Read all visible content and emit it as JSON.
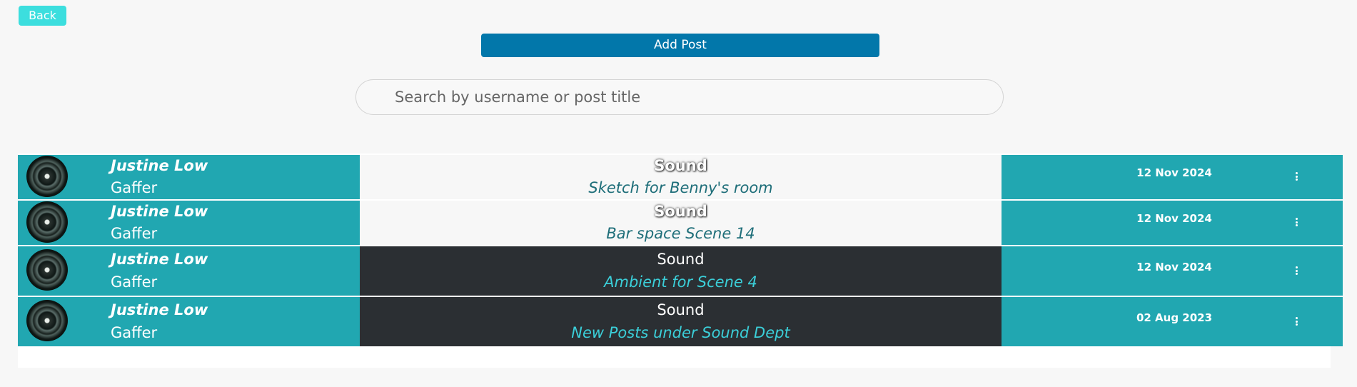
{
  "toolbar": {
    "back_label": "Back",
    "add_post_label": "Add Post"
  },
  "search": {
    "placeholder": "Search by username or post title",
    "value": ""
  },
  "posts": [
    {
      "username": "Justine Low",
      "role": "Gaffer",
      "department": "Sound",
      "title": "Sketch for Benny's room",
      "date": "12 Nov 2024",
      "theme": "light"
    },
    {
      "username": "Justine Low",
      "role": "Gaffer",
      "department": "Sound",
      "title": "Bar space Scene 14",
      "date": "12 Nov 2024",
      "theme": "light"
    },
    {
      "username": "Justine Low",
      "role": "Gaffer",
      "department": "Sound",
      "title": "Ambient for Scene 4",
      "date": "12 Nov 2024",
      "theme": "dark"
    },
    {
      "username": "Justine Low",
      "role": "Gaffer",
      "department": "Sound",
      "title": "New Posts under Sound Dept",
      "date": "02 Aug 2023",
      "theme": "dark"
    }
  ],
  "colors": {
    "accent_teal": "#21a7b1",
    "back_button": "#3cdede",
    "add_post_button": "#0277aa",
    "dark_cell": "#2b2f33"
  },
  "icons": {
    "row_menu": "more-vertical-icon",
    "avatar": "avatar"
  }
}
